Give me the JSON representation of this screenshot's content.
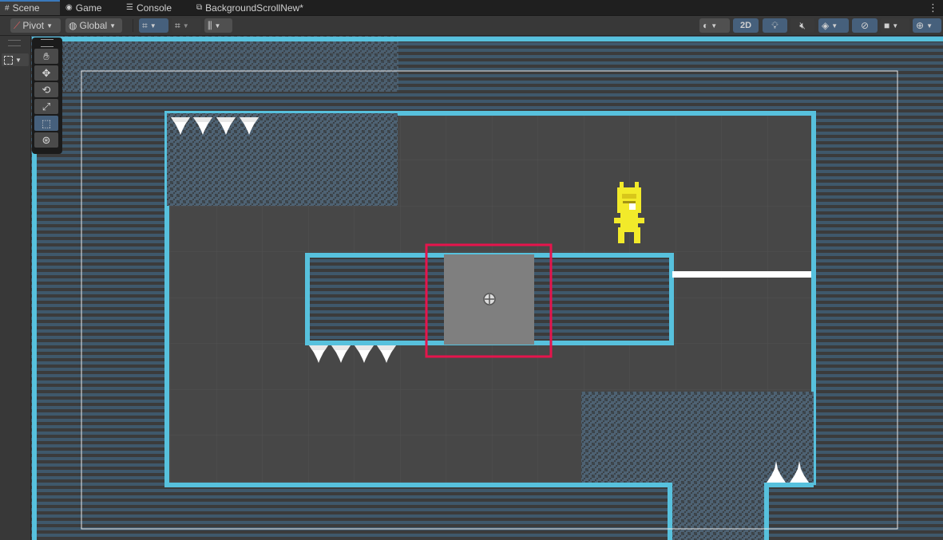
{
  "tabs": [
    {
      "label": "Scene",
      "icon": "grid-icon",
      "active": true
    },
    {
      "label": "Game",
      "icon": "gamepad-icon",
      "active": false
    },
    {
      "label": "Console",
      "icon": "console-icon",
      "active": false
    },
    {
      "label": "BackgroundScrollNew*",
      "icon": "prefab-icon",
      "active": false
    }
  ],
  "toolbar": {
    "pivot_label": "Pivot",
    "global_label": "Global",
    "mode_2d_label": "2D"
  },
  "tools": [
    {
      "name": "hand-tool",
      "icon": "hand-icon"
    },
    {
      "name": "move-tool",
      "icon": "move-icon"
    },
    {
      "name": "rotate-tool",
      "icon": "rotate-icon"
    },
    {
      "name": "scale-tool",
      "icon": "scale-icon"
    },
    {
      "name": "rect-tool",
      "icon": "rect-icon",
      "active": true
    },
    {
      "name": "transform-tool",
      "icon": "transform-icon"
    }
  ],
  "colors": {
    "tile_outline": "#57c1dd",
    "tile_fill": "#3f586b",
    "selection": "#e6144c",
    "character": "#f2ea2a",
    "accent": "#46607c"
  }
}
